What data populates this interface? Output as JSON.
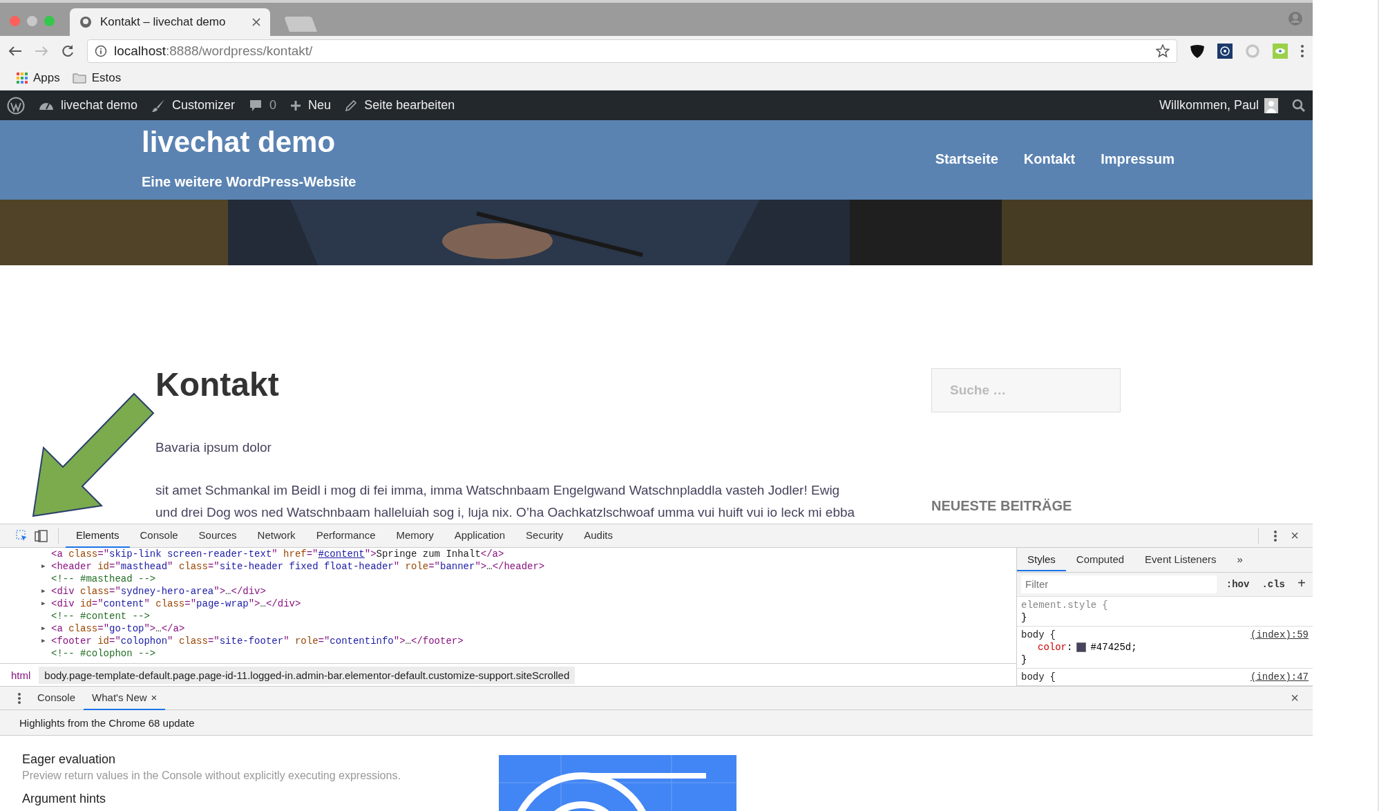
{
  "browser": {
    "tab": {
      "title": "Kontakt – livechat demo"
    },
    "url": {
      "host": "localhost",
      "path": ":8888/wordpress/kontakt/"
    },
    "bookmarks": [
      {
        "kind": "apps",
        "label": "Apps"
      },
      {
        "kind": "folder",
        "label": "Estos"
      }
    ]
  },
  "admin_bar": {
    "items": [
      {
        "kind": "wp"
      },
      {
        "kind": "dashboard",
        "label": "livechat demo"
      },
      {
        "kind": "brush",
        "label": "Customizer"
      },
      {
        "kind": "comments",
        "label": "0"
      },
      {
        "kind": "plus",
        "label": "Neu"
      },
      {
        "kind": "pencil",
        "label": "Seite bearbeiten"
      }
    ],
    "greeting": "Willkommen, Paul"
  },
  "site": {
    "title": "livechat demo",
    "tagline": "Eine weitere WordPress-Website",
    "nav": [
      {
        "label": "Startseite"
      },
      {
        "label": "Kontakt"
      },
      {
        "label": "Impressum"
      }
    ]
  },
  "page": {
    "heading": "Kontakt",
    "lines": [
      "Bavaria ipsum dolor",
      "sit amet Schmankal im Beidl i mog di fei imma, imma Watschnbaam Engelgwand Watschnpladdla vasteh Jodler! Ewig",
      "und drei Dog wos ned Watschnbaam halleluiah sog i, luja nix. O’ha Oachkatzlschwoaf umma vui huift vui io leck mi ebba"
    ]
  },
  "sidebar": {
    "search": {
      "placeholder": "Suche …"
    },
    "widget_title": "NEUESTE BEITRÄGE"
  },
  "devtools": {
    "tabs": [
      {
        "label": "Elements",
        "selected": true
      },
      {
        "label": "Console",
        "selected": false
      },
      {
        "label": "Sources",
        "selected": false
      },
      {
        "label": "Network",
        "selected": false
      },
      {
        "label": "Performance",
        "selected": false
      },
      {
        "label": "Memory",
        "selected": false
      },
      {
        "label": "Application",
        "selected": false
      },
      {
        "label": "Security",
        "selected": false
      },
      {
        "label": "Audits",
        "selected": false
      }
    ],
    "dom": [
      {
        "expandable": false,
        "segments": [
          {
            "kind": "tag",
            "text": "<a "
          },
          {
            "kind": "attr",
            "text": "class"
          },
          {
            "kind": "tag",
            "text": "=\""
          },
          {
            "kind": "value",
            "text": "skip-link screen-reader-text"
          },
          {
            "kind": "tag",
            "text": "\" "
          },
          {
            "kind": "attr",
            "text": "href"
          },
          {
            "kind": "tag",
            "text": "=\""
          },
          {
            "kind": "link",
            "text": "#content"
          },
          {
            "kind": "tag",
            "text": "\">"
          },
          {
            "kind": "text",
            "text": "Springe zum Inhalt"
          },
          {
            "kind": "tag",
            "text": "</a>"
          }
        ]
      },
      {
        "expandable": true,
        "segments": [
          {
            "kind": "tag",
            "text": "<header "
          },
          {
            "kind": "attr",
            "text": "id"
          },
          {
            "kind": "tag",
            "text": "=\""
          },
          {
            "kind": "value",
            "text": "masthead"
          },
          {
            "kind": "tag",
            "text": "\" "
          },
          {
            "kind": "attr",
            "text": "class"
          },
          {
            "kind": "tag",
            "text": "=\""
          },
          {
            "kind": "value",
            "text": "site-header fixed float-header"
          },
          {
            "kind": "tag",
            "text": "\" "
          },
          {
            "kind": "attr",
            "text": "role"
          },
          {
            "kind": "tag",
            "text": "=\""
          },
          {
            "kind": "value",
            "text": "banner"
          },
          {
            "kind": "tag",
            "text": "\">"
          },
          {
            "kind": "text",
            "text": "…"
          },
          {
            "kind": "tag",
            "text": "</header>"
          }
        ]
      },
      {
        "expandable": false,
        "segments": [
          {
            "kind": "comment",
            "text": "<!-- #masthead -->"
          }
        ]
      },
      {
        "expandable": true,
        "segments": [
          {
            "kind": "tag",
            "text": "<div "
          },
          {
            "kind": "attr",
            "text": "class"
          },
          {
            "kind": "tag",
            "text": "=\""
          },
          {
            "kind": "value",
            "text": "sydney-hero-area"
          },
          {
            "kind": "tag",
            "text": "\">"
          },
          {
            "kind": "text",
            "text": "…"
          },
          {
            "kind": "tag",
            "text": "</div>"
          }
        ]
      },
      {
        "expandable": true,
        "segments": [
          {
            "kind": "tag",
            "text": "<div "
          },
          {
            "kind": "attr",
            "text": "id"
          },
          {
            "kind": "tag",
            "text": "=\""
          },
          {
            "kind": "value",
            "text": "content"
          },
          {
            "kind": "tag",
            "text": "\" "
          },
          {
            "kind": "attr",
            "text": "class"
          },
          {
            "kind": "tag",
            "text": "=\""
          },
          {
            "kind": "value",
            "text": "page-wrap"
          },
          {
            "kind": "tag",
            "text": "\">"
          },
          {
            "kind": "text",
            "text": "…"
          },
          {
            "kind": "tag",
            "text": "</div>"
          }
        ]
      },
      {
        "expandable": false,
        "segments": [
          {
            "kind": "comment",
            "text": "<!-- #content -->"
          }
        ]
      },
      {
        "expandable": true,
        "segments": [
          {
            "kind": "tag",
            "text": "<a "
          },
          {
            "kind": "attr",
            "text": "class"
          },
          {
            "kind": "tag",
            "text": "=\""
          },
          {
            "kind": "value",
            "text": "go-top"
          },
          {
            "kind": "tag",
            "text": "\">"
          },
          {
            "kind": "text",
            "text": "…"
          },
          {
            "kind": "tag",
            "text": "</a>"
          }
        ]
      },
      {
        "expandable": true,
        "segments": [
          {
            "kind": "tag",
            "text": "<footer "
          },
          {
            "kind": "attr",
            "text": "id"
          },
          {
            "kind": "tag",
            "text": "=\""
          },
          {
            "kind": "value",
            "text": "colophon"
          },
          {
            "kind": "tag",
            "text": "\" "
          },
          {
            "kind": "attr",
            "text": "class"
          },
          {
            "kind": "tag",
            "text": "=\""
          },
          {
            "kind": "value",
            "text": "site-footer"
          },
          {
            "kind": "tag",
            "text": "\" "
          },
          {
            "kind": "attr",
            "text": "role"
          },
          {
            "kind": "tag",
            "text": "=\""
          },
          {
            "kind": "value",
            "text": "contentinfo"
          },
          {
            "kind": "tag",
            "text": "\">"
          },
          {
            "kind": "text",
            "text": "…"
          },
          {
            "kind": "tag",
            "text": "</footer>"
          }
        ]
      },
      {
        "expandable": false,
        "segments": [
          {
            "kind": "comment",
            "text": "<!-- #colophon -->"
          }
        ]
      }
    ],
    "breadcrumbs": [
      {
        "label": "html",
        "selected": false
      },
      {
        "label": "body.page-template-default.page.page-id-11.logged-in.admin-bar.elementor-default.customize-support.siteScrolled",
        "selected": true
      }
    ],
    "side_tabs": [
      {
        "label": "Styles",
        "selected": true
      },
      {
        "label": "Computed",
        "selected": false
      },
      {
        "label": "Event Listeners",
        "selected": false
      }
    ],
    "more": "»",
    "filter": {
      "placeholder": "Filter"
    },
    "hov": ":hov",
    "cls": ".cls",
    "add": "+",
    "toggle": "▶",
    "rules": [
      {
        "selector": "element.style",
        "open": "{",
        "close": "}"
      },
      {
        "selector": "body",
        "open": "{",
        "source": "(index):59",
        "declarations": [
          {
            "property": "color",
            "colon": ":",
            "value": "#47425d",
            "end": ";",
            "swatch": true
          }
        ],
        "close": "}"
      },
      {
        "selector": "body",
        "open": "{",
        "source": "(index):47"
      }
    ],
    "drawer_tabs": [
      {
        "label": "Console",
        "selected": false,
        "closable": false
      },
      {
        "label": "What's New",
        "selected": true,
        "closable": true
      }
    ],
    "close": "×",
    "highlights": "Highlights from the Chrome 68 update",
    "features": [
      {
        "title": "Eager evaluation",
        "description": "Preview return values in the Console without explicitly executing expressions."
      },
      {
        "title": "Argument hints"
      }
    ]
  }
}
